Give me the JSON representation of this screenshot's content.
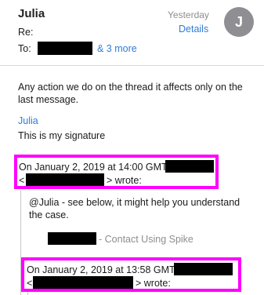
{
  "header": {
    "sender": "Julia",
    "date": "Yesterday",
    "details_label": "Details",
    "avatar_initial": "J",
    "re_label": "Re:",
    "to_label": "To:",
    "more_recipients": "& 3 more"
  },
  "message": {
    "body_line1": "Any action we do on the thread it affects only on the",
    "body_line2": "last message.",
    "signature_name": "Julia",
    "signature_text": "This is my signature"
  },
  "quote1": {
    "attribution_line1": "On January 2, 2019 at 14:00 GMT,",
    "attribution_open": "<",
    "attribution_close": "> wrote:",
    "text_line1": "@Julia - see below, it might help you understand",
    "text_line2": "the case.",
    "contact_suffix": "- Contact Using Spike"
  },
  "quote2": {
    "attribution_line1": "On January 2, 2019 at 13:58 GMT,",
    "attribution_open": "<",
    "attribution_close": "> wrote:"
  },
  "colors": {
    "accent_link": "#2f7bd9",
    "highlight": "#ff00ff",
    "muted": "#8e8e93",
    "redaction": "#000000"
  }
}
